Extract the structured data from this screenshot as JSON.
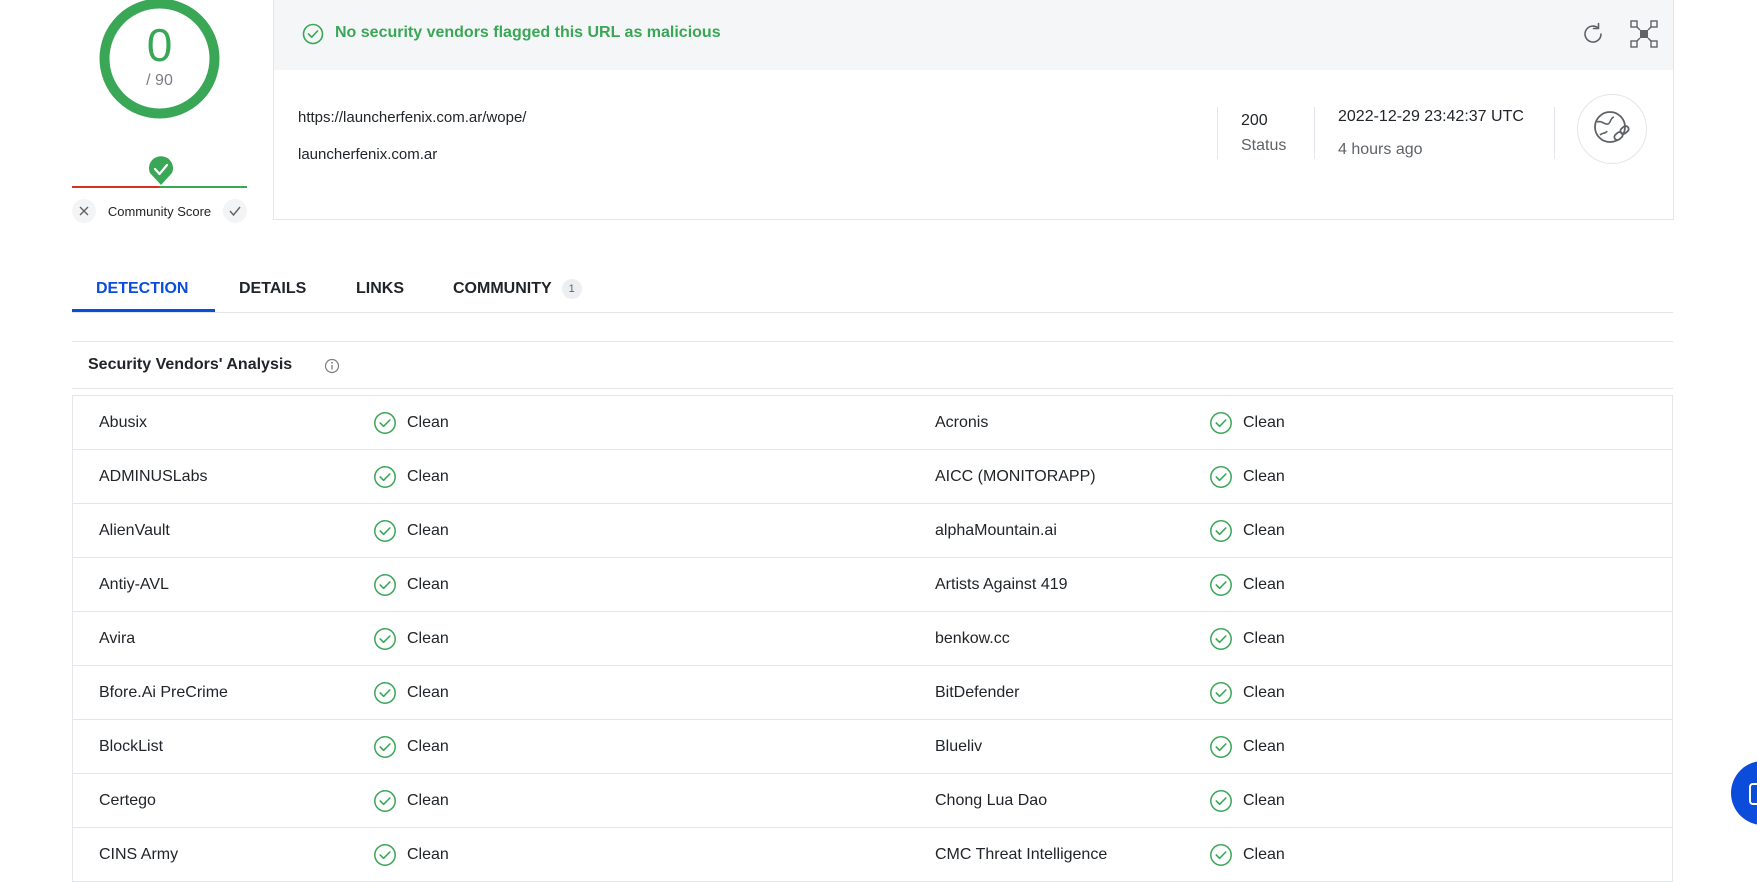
{
  "score": {
    "positives": "0",
    "total": "/ 90",
    "community_label": "Community Score",
    "colors": {
      "clean": "#3aa757",
      "malicious": "#d93025"
    }
  },
  "banner": {
    "message": "No security vendors flagged this URL as malicious",
    "icons": [
      "check-circle-icon",
      "reanalyze-icon",
      "graph-icon"
    ]
  },
  "url_info": {
    "url": "https://launcherfenix.com.ar/wope/",
    "domain": "launcherfenix.com.ar",
    "status_code": "200",
    "status_label": "Status",
    "scan_date": "2022-12-29 23:42:37 UTC",
    "scan_ago": "4 hours ago",
    "avatar_icon": "globe-link-icon"
  },
  "tabs": [
    {
      "label": "DETECTION",
      "active": true
    },
    {
      "label": "DETAILS"
    },
    {
      "label": "LINKS"
    },
    {
      "label": "COMMUNITY",
      "badge": "1"
    }
  ],
  "vendors": {
    "title": "Security Vendors' Analysis",
    "rows": [
      {
        "left": {
          "name": "Abusix",
          "result": "Clean"
        },
        "right": {
          "name": "Acronis",
          "result": "Clean"
        }
      },
      {
        "left": {
          "name": "ADMINUSLabs",
          "result": "Clean"
        },
        "right": {
          "name": "AICC (MONITORAPP)",
          "result": "Clean"
        }
      },
      {
        "left": {
          "name": "AlienVault",
          "result": "Clean"
        },
        "right": {
          "name": "alphaMountain.ai",
          "result": "Clean"
        }
      },
      {
        "left": {
          "name": "Antiy-AVL",
          "result": "Clean"
        },
        "right": {
          "name": "Artists Against 419",
          "result": "Clean"
        }
      },
      {
        "left": {
          "name": "Avira",
          "result": "Clean"
        },
        "right": {
          "name": "benkow.cc",
          "result": "Clean"
        }
      },
      {
        "left": {
          "name": "Bfore.Ai PreCrime",
          "result": "Clean"
        },
        "right": {
          "name": "BitDefender",
          "result": "Clean"
        }
      },
      {
        "left": {
          "name": "BlockList",
          "result": "Clean"
        },
        "right": {
          "name": "Blueliv",
          "result": "Clean"
        }
      },
      {
        "left": {
          "name": "Certego",
          "result": "Clean"
        },
        "right": {
          "name": "Chong Lua Dao",
          "result": "Clean"
        }
      },
      {
        "left": {
          "name": "CINS Army",
          "result": "Clean"
        },
        "right": {
          "name": "CMC Threat Intelligence",
          "result": "Clean"
        }
      }
    ]
  },
  "chat": {
    "icon": "chat-icon",
    "color": "#0b4dda"
  }
}
